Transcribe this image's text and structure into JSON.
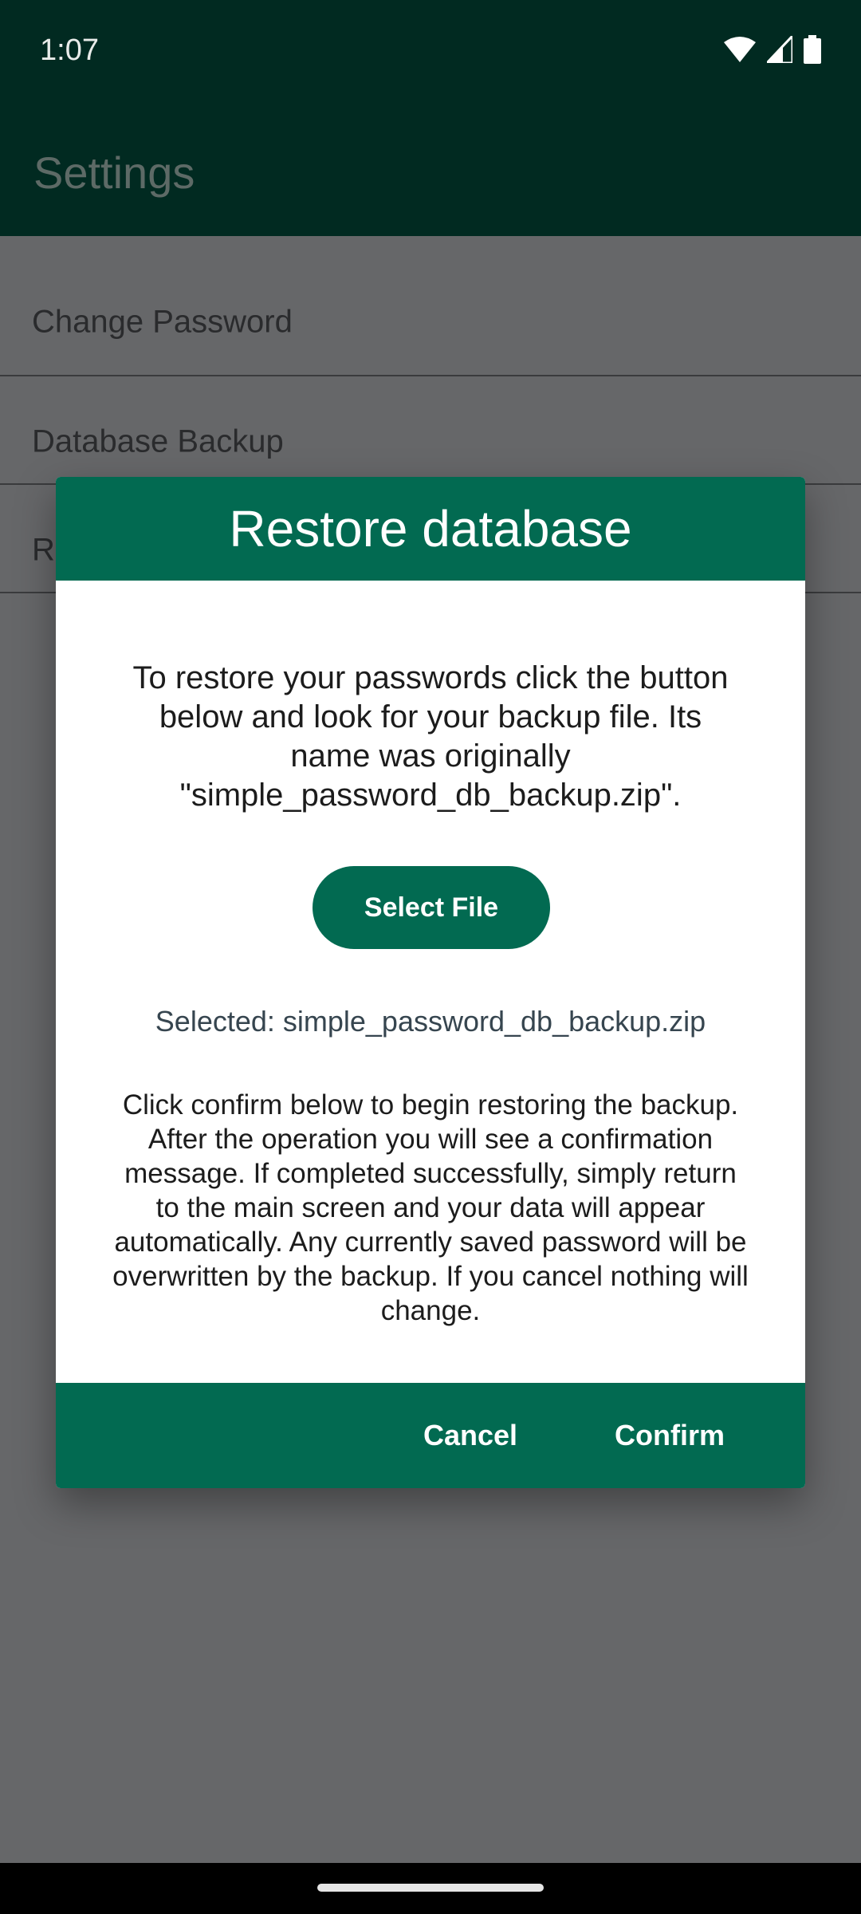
{
  "status_bar": {
    "time": "1:07",
    "icons": [
      "wifi-icon",
      "signal-icon",
      "battery-icon"
    ]
  },
  "app_bar": {
    "title": "Settings"
  },
  "settings": {
    "items": [
      {
        "label": "Change Password"
      },
      {
        "label": "Database Backup"
      },
      {
        "label": "Re"
      }
    ]
  },
  "dialog": {
    "title": "Restore database",
    "intro": "To restore your passwords click the button below and look for your backup file. Its name was originally \"simple_password_db_backup.zip\".",
    "select_file_label": "Select File",
    "selected_text": "Selected: simple_password_db_backup.zip",
    "info": "Click confirm below to begin restoring the backup. After the operation you will see a confirmation message. If completed successfully, simply return to the main screen and your data will appear automatically. Any currently saved password will be overwritten by the backup. If you cancel nothing will change.",
    "cancel_label": "Cancel",
    "confirm_label": "Confirm"
  },
  "colors": {
    "primary": "#026a51",
    "status_bar": "#012a21",
    "scrim": "#666769"
  }
}
